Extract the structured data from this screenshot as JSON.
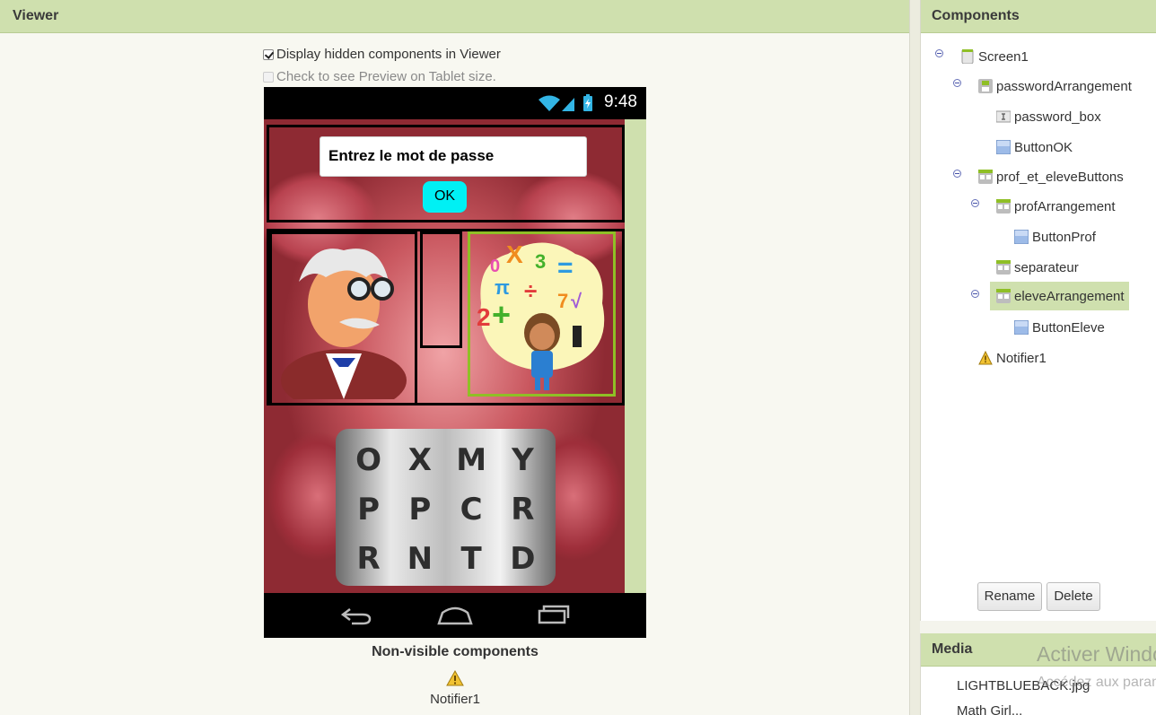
{
  "viewer": {
    "title": "Viewer",
    "display_hidden_label": "Display hidden components in Viewer",
    "display_hidden_checked": true,
    "tablet_preview_label": "Check to see Preview on Tablet size.",
    "tablet_preview_checked": false,
    "phone": {
      "time": "9:48",
      "password_box_text": "Entrez le mot de passe",
      "ok_button_label": "OK",
      "lock_letters": [
        [
          "O",
          "P",
          "R"
        ],
        [
          "X",
          "P",
          "N"
        ],
        [
          "M",
          "C",
          "T"
        ],
        [
          "Y",
          "R",
          "D"
        ]
      ]
    },
    "non_visible_title": "Non-visible components",
    "non_visible_items": [
      "Notifier1"
    ]
  },
  "components": {
    "title": "Components",
    "tree": [
      {
        "label": "Screen1",
        "icon": "screen-icon"
      },
      {
        "label": "passwordArrangement",
        "icon": "vertical-arrangement-icon"
      },
      {
        "label": "password_box",
        "icon": "textbox-icon"
      },
      {
        "label": "ButtonOK",
        "icon": "button-icon"
      },
      {
        "label": "prof_et_eleveButtons",
        "icon": "horizontal-arrangement-icon"
      },
      {
        "label": "profArrangement",
        "icon": "horizontal-arrangement-icon"
      },
      {
        "label": "ButtonProf",
        "icon": "button-icon"
      },
      {
        "label": "separateur",
        "icon": "horizontal-arrangement-icon"
      },
      {
        "label": "eleveArrangement",
        "icon": "horizontal-arrangement-icon",
        "selected": true
      },
      {
        "label": "ButtonEleve",
        "icon": "button-icon"
      },
      {
        "label": "Notifier1",
        "icon": "warning-icon"
      }
    ],
    "rename_label": "Rename",
    "delete_label": "Delete"
  },
  "media": {
    "title": "Media",
    "items": [
      "LIGHTBLUEBACK.jpg",
      "Math Girl..."
    ]
  },
  "watermark": {
    "line1": "Activer Windows",
    "line2": "Accédez aux paramètres"
  },
  "colors": {
    "header_green": "#cfe0ae",
    "ok_button": "#00f0f4",
    "selection_border": "#8fbf26"
  }
}
